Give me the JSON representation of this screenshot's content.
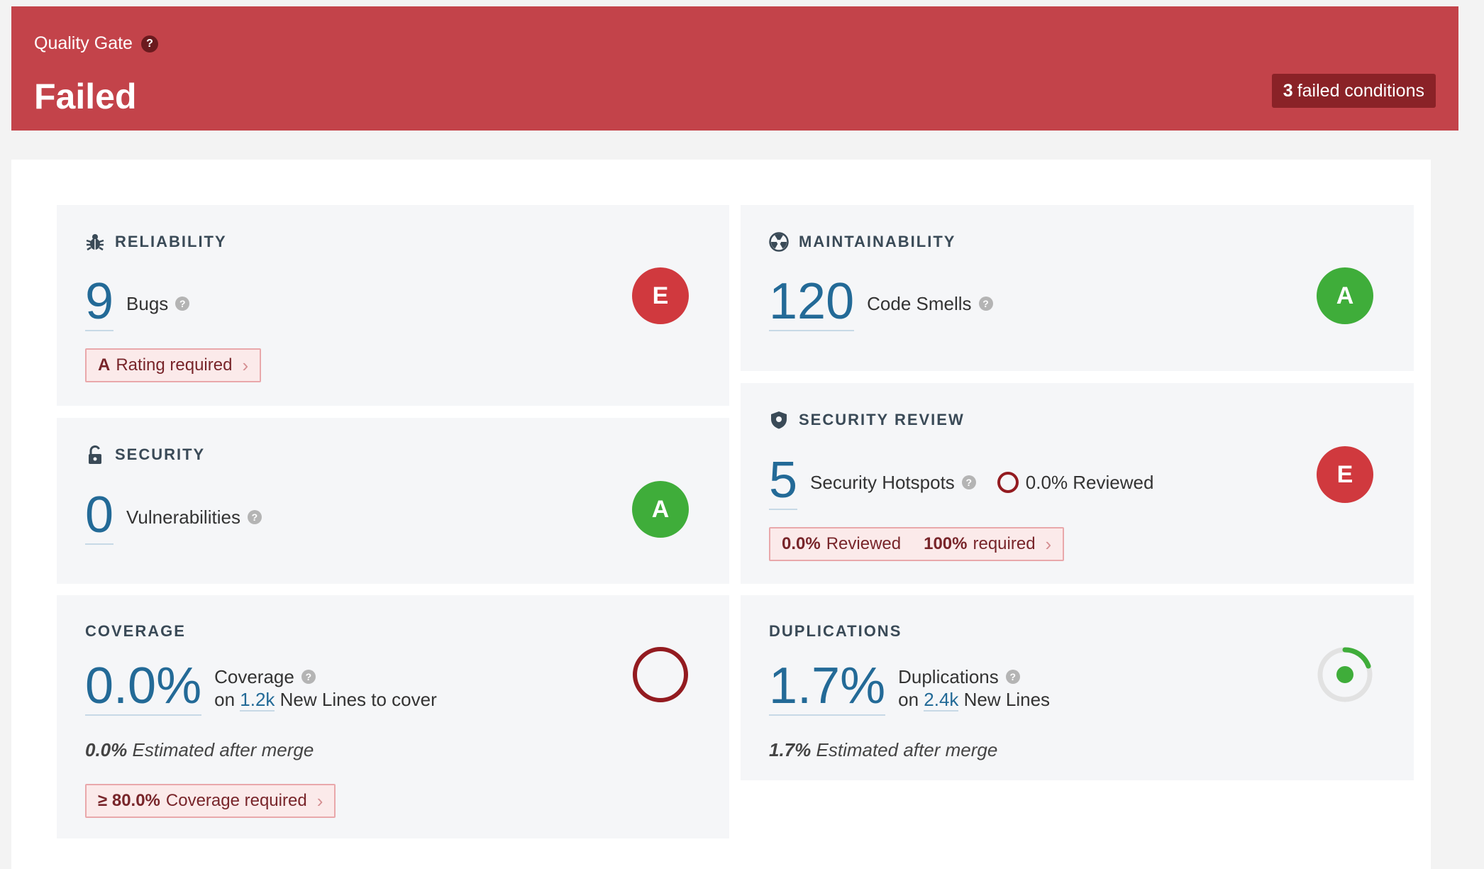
{
  "quality_gate": {
    "label": "Quality Gate",
    "help": "?",
    "status": "Failed",
    "failed_count": "3",
    "failed_text": "failed conditions"
  },
  "reliability": {
    "title": "RELIABILITY",
    "icon": "bug-icon",
    "value": "9",
    "label": "Bugs",
    "rating": "E",
    "requirement_bold": "A",
    "requirement_text": "Rating required"
  },
  "security": {
    "title": "SECURITY",
    "icon": "lock-icon",
    "value": "0",
    "label": "Vulnerabilities",
    "rating": "A"
  },
  "coverage": {
    "title": "COVERAGE",
    "value": "0.0%",
    "label": "Coverage",
    "on": "on",
    "lines": "1.2k",
    "lines_text": "New Lines to cover",
    "estimate_bold": "0.0%",
    "estimate_text": "Estimated after merge",
    "requirement_bold": "≥ 80.0%",
    "requirement_text": "Coverage required",
    "coverage_percent": 0.0
  },
  "maintainability": {
    "title": "MAINTAINABILITY",
    "icon": "radiation-icon",
    "value": "120",
    "label": "Code Smells",
    "rating": "A"
  },
  "security_review": {
    "title": "SECURITY REVIEW",
    "icon": "shield-icon",
    "value": "5",
    "label": "Security Hotspots",
    "reviewed_inline": "0.0% Reviewed",
    "rating": "E",
    "req_reviewed_bold": "0.0%",
    "req_reviewed_text": "Reviewed",
    "req_required_bold": "100%",
    "req_required_text": "required"
  },
  "duplications": {
    "title": "DUPLICATIONS",
    "value": "1.7%",
    "label": "Duplications",
    "on": "on",
    "lines": "2.4k",
    "lines_text": "New Lines",
    "estimate_bold": "1.7%",
    "estimate_text": "Estimated after merge",
    "duplication_percent": 1.7
  },
  "colors": {
    "banner": "#c3434a",
    "bad_rating": "#d0393e",
    "good_rating": "#3fad3a",
    "metric_blue": "#236a97"
  }
}
